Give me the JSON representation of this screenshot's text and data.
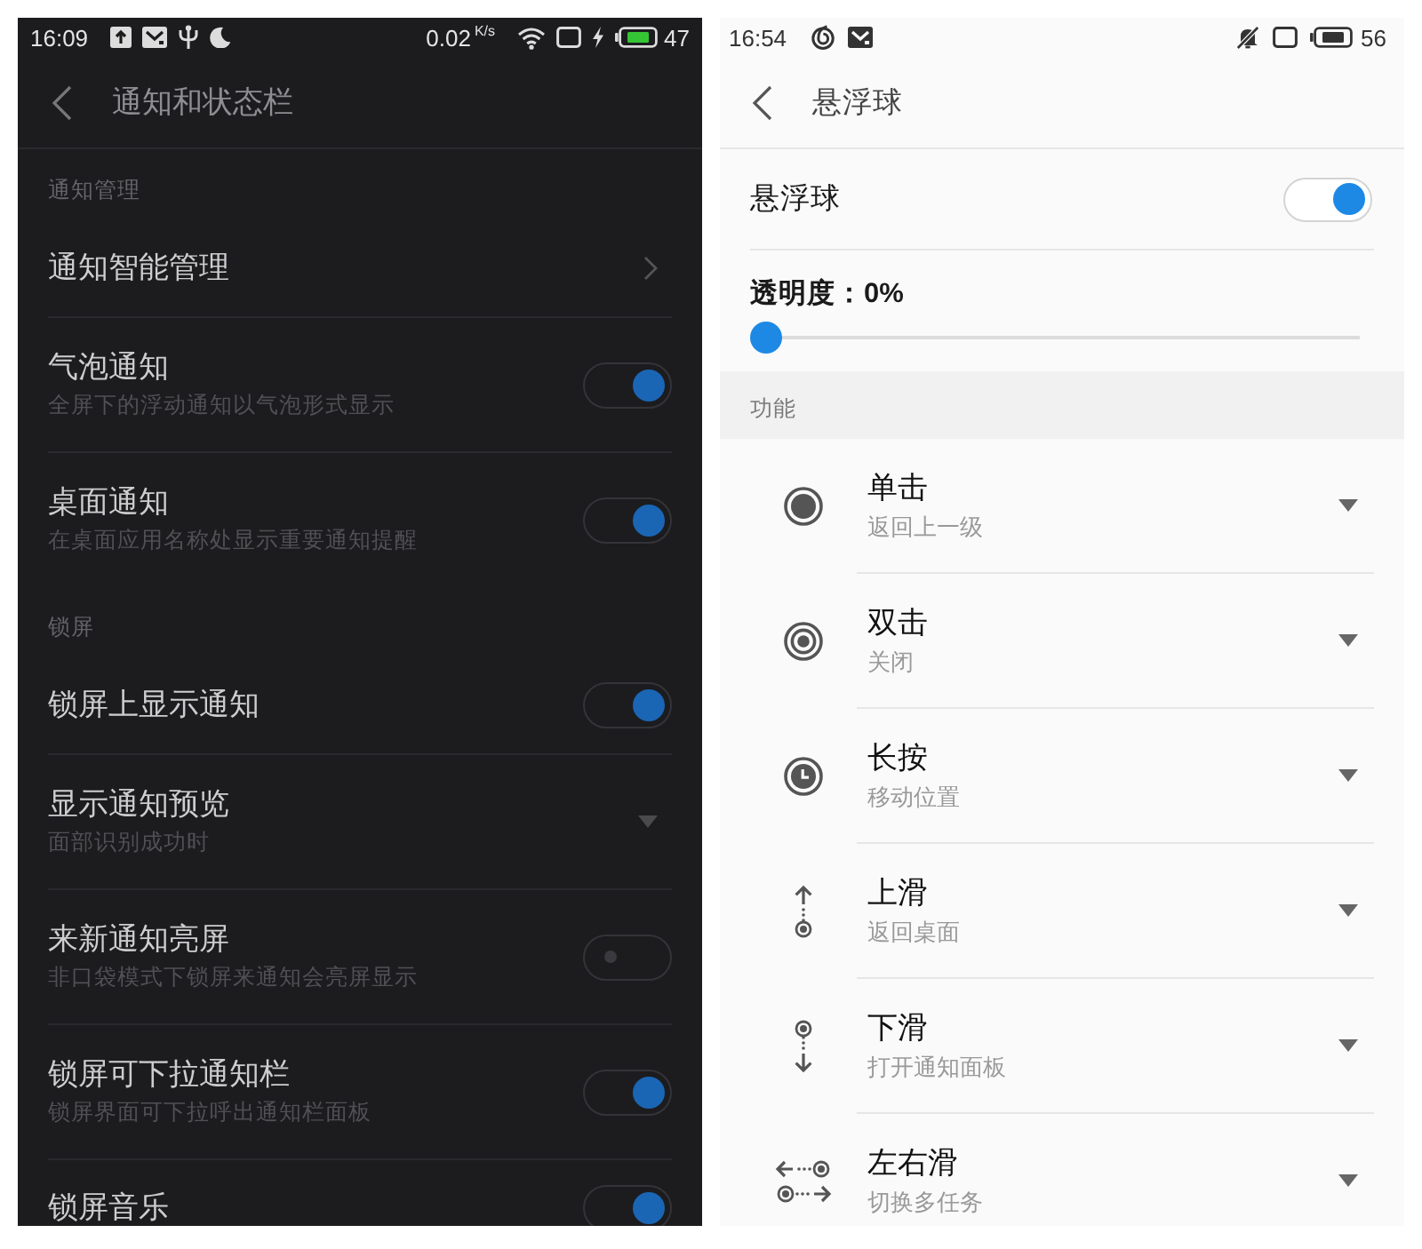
{
  "left_screen": {
    "status_bar": {
      "time": "16:09",
      "network_speed": "0.02",
      "speed_unit": "K/s",
      "battery": "47"
    },
    "header": {
      "title": "通知和状态栏"
    },
    "sections": [
      {
        "title": "通知管理",
        "items": [
          {
            "kind": "link",
            "title": "通知智能管理"
          },
          {
            "kind": "switch",
            "title": "气泡通知",
            "subtitle": "全屏下的浮动通知以气泡形式显示",
            "on": true
          },
          {
            "kind": "switch",
            "title": "桌面通知",
            "subtitle": "在桌面应用名称处显示重要通知提醒",
            "on": true
          }
        ]
      },
      {
        "title": "锁屏",
        "items": [
          {
            "kind": "switch",
            "title": "锁屏上显示通知",
            "on": true
          },
          {
            "kind": "dropdown",
            "title": "显示通知预览",
            "subtitle": "面部识别成功时"
          },
          {
            "kind": "switch",
            "title": "来新通知亮屏",
            "subtitle": "非口袋模式下锁屏来通知会亮屏显示",
            "on": false
          },
          {
            "kind": "switch",
            "title": "锁屏可下拉通知栏",
            "subtitle": "锁屏界面可下拉呼出通知栏面板",
            "on": true
          },
          {
            "kind": "switch",
            "title": "锁屏音乐",
            "on": true
          }
        ]
      }
    ]
  },
  "right_screen": {
    "status_bar": {
      "time": "16:54",
      "battery": "56"
    },
    "header": {
      "title": "悬浮球"
    },
    "main_switch": {
      "title": "悬浮球",
      "on": true
    },
    "opacity": {
      "label": "透明度：0%",
      "level": 0
    },
    "functions": {
      "title": "功能",
      "items": [
        {
          "kind": "tap",
          "title": "单击",
          "value": "返回上一级"
        },
        {
          "kind": "double_tap",
          "title": "双击",
          "value": "关闭"
        },
        {
          "kind": "long_press",
          "title": "长按",
          "value": "移动位置"
        },
        {
          "kind": "swipe_up",
          "title": "上滑",
          "value": "返回桌面"
        },
        {
          "kind": "swipe_down",
          "title": "下滑",
          "value": "打开通知面板"
        },
        {
          "kind": "swipe_sideways",
          "title": "左右滑",
          "value": "切换多任务"
        }
      ]
    }
  }
}
